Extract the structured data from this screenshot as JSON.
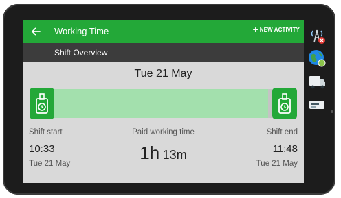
{
  "appbar": {
    "title": "Working Time",
    "new_activity_label": "NEW ACTIVITY",
    "back_icon": "arrow-left-icon"
  },
  "subheader": {
    "title": "Shift Overview"
  },
  "shift": {
    "date": "Tue 21 May",
    "start": {
      "label": "Shift start",
      "time": "10:33",
      "date": "Tue 21 May"
    },
    "paid": {
      "label": "Paid working time",
      "hours": "1h",
      "minutes": "13m"
    },
    "end": {
      "label": "Shift end",
      "time": "11:48",
      "date": "Tue 21 May"
    }
  },
  "timeline": {
    "start_icon": "shift-start-icon",
    "end_icon": "shift-end-icon"
  },
  "side_rail": {
    "icons": [
      "signal-tower-icon",
      "globe-icon",
      "truck-icon",
      "card-reader-icon"
    ]
  },
  "colors": {
    "accent": "#23a838",
    "header_dark": "#3c3c3c",
    "timeline_fill": "#a3e0ad",
    "screen_bg": "#d9d9d9"
  }
}
